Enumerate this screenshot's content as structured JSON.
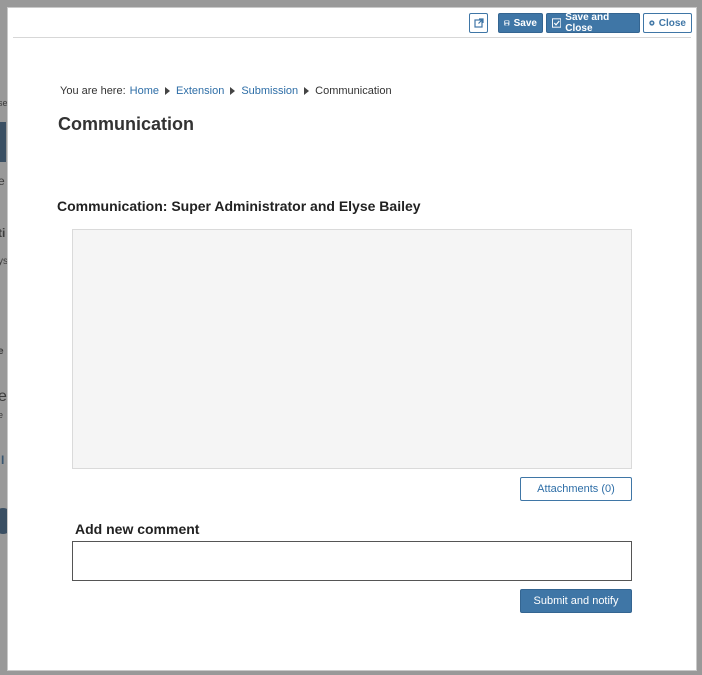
{
  "background_page": {
    "fragments": [
      "se",
      "e",
      "ti",
      "ys",
      "e",
      "e",
      "e",
      "I"
    ]
  },
  "toolbar": {
    "popout_icon": "external-link-icon",
    "save_label": "Save",
    "save_icon": "floppy-disk-icon",
    "save_close_label": "Save and Close",
    "save_close_icon": "checkbox-icon",
    "close_label": "Close",
    "close_icon": "close-circle-icon"
  },
  "breadcrumb": {
    "prefix": "You are here:",
    "items": [
      "Home",
      "Extension",
      "Submission"
    ],
    "current": "Communication"
  },
  "page_title": "Communication",
  "communication": {
    "title": "Communication: Super Administrator and Elyse Bailey",
    "attachments_label": "Attachments (0)"
  },
  "comment": {
    "label": "Add new comment",
    "value": "",
    "placeholder": "",
    "submit_label": "Submit and notify"
  },
  "colors": {
    "primary": "#3f76a6",
    "link": "#2e6ea7",
    "overlay": "#8a8a8a"
  }
}
